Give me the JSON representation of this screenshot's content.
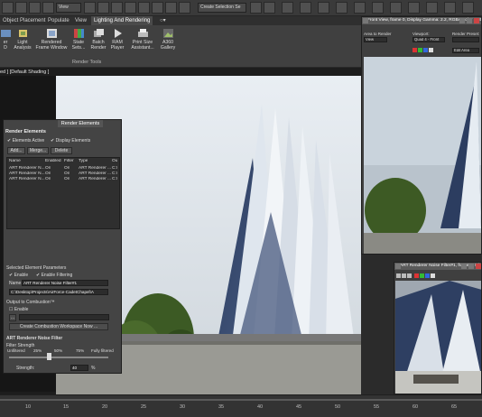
{
  "toolbar": {
    "view_dropdown": "View",
    "selection_set_dropdown": "Create Selection Se"
  },
  "tabs": [
    {
      "label": "Object Placement"
    },
    {
      "label": "Populate"
    },
    {
      "label": "View"
    },
    {
      "label": "Lighting And Rendering"
    }
  ],
  "ribbon": {
    "group_label": "Render Tools",
    "buttons": [
      {
        "label": "er\nD"
      },
      {
        "label": "Light\nAnalysis"
      },
      {
        "label": "Rendered\nFrame Window"
      },
      {
        "label": "State\nSets..."
      },
      {
        "label": "Batch\nRender"
      },
      {
        "label": "RAM\nPlayer"
      },
      {
        "label": "Print Size\nAssistant..."
      },
      {
        "label": "A360\nGallery"
      }
    ]
  },
  "viewport": {
    "label": "ed ] [Default Shading ]"
  },
  "render_elements": {
    "tab": "Render Elements",
    "title": "Render Elements",
    "elements_active": "Elements Active",
    "display_elements": "Display Elements",
    "add_button": "Add...",
    "merge_button": "Merge...",
    "delete_button": "Delete",
    "columns": [
      "Name",
      "Enabled",
      "Filter",
      "Type",
      "Ou"
    ],
    "rows": [
      [
        "ART Renderer N...",
        "On",
        "On",
        "ART Renderer ...",
        "C:\\"
      ],
      [
        "ART Renderer N...",
        "On",
        "On",
        "ART Renderer ...",
        "C:\\"
      ],
      [
        "ART Renderer N...",
        "On",
        "On",
        "ART Renderer ...",
        "C:\\"
      ]
    ],
    "selected_params_label": "Selected Element Parameters",
    "enable": "Enable",
    "enable_filtering": "Enable Filtering",
    "name_label": "Name:",
    "name_value": "ART Renderer Noise Filter#1",
    "path_value": "C:\\Desktop\\Projects\\AirForce-CadetChapel\\A",
    "output_label": "Output to Combustion™",
    "output_enable": "Enable",
    "create_button": "Create Combustion Workspace Now ...",
    "noise_filter_title": "ART Renderer Noise Filter",
    "filter_strength": "Filter Strength",
    "unfiltered": "Unfiltered",
    "p25": "25%",
    "p50": "50%",
    "p75": "75%",
    "fully": "Fully filtered",
    "strength_label": "Strength:",
    "strength_value": "40",
    "strength_unit": "%",
    "strength_fraction": 0.4
  },
  "render_window_1": {
    "title": "Front View, frame 0, Display Gamma: 2.2, RGBA Color 32 Bits/Channel (1:1)",
    "area_label": "Area to Render",
    "area_value": "View",
    "viewport_label": "Viewport:",
    "viewport_value": "Quad 4 - Front",
    "preset_label": "Render Preset:",
    "preset_value": "Edit Area"
  },
  "render_window_2": {
    "title": "ART Renderer Noise Filter#1, frame 0, Display Gamma: 2.2, RGBA Color 32 Bits/Channel"
  },
  "timeline": {
    "ticks": [
      "10",
      "15",
      "20",
      "25",
      "30",
      "35",
      "40",
      "45",
      "50",
      "55",
      "60",
      "65"
    ]
  }
}
